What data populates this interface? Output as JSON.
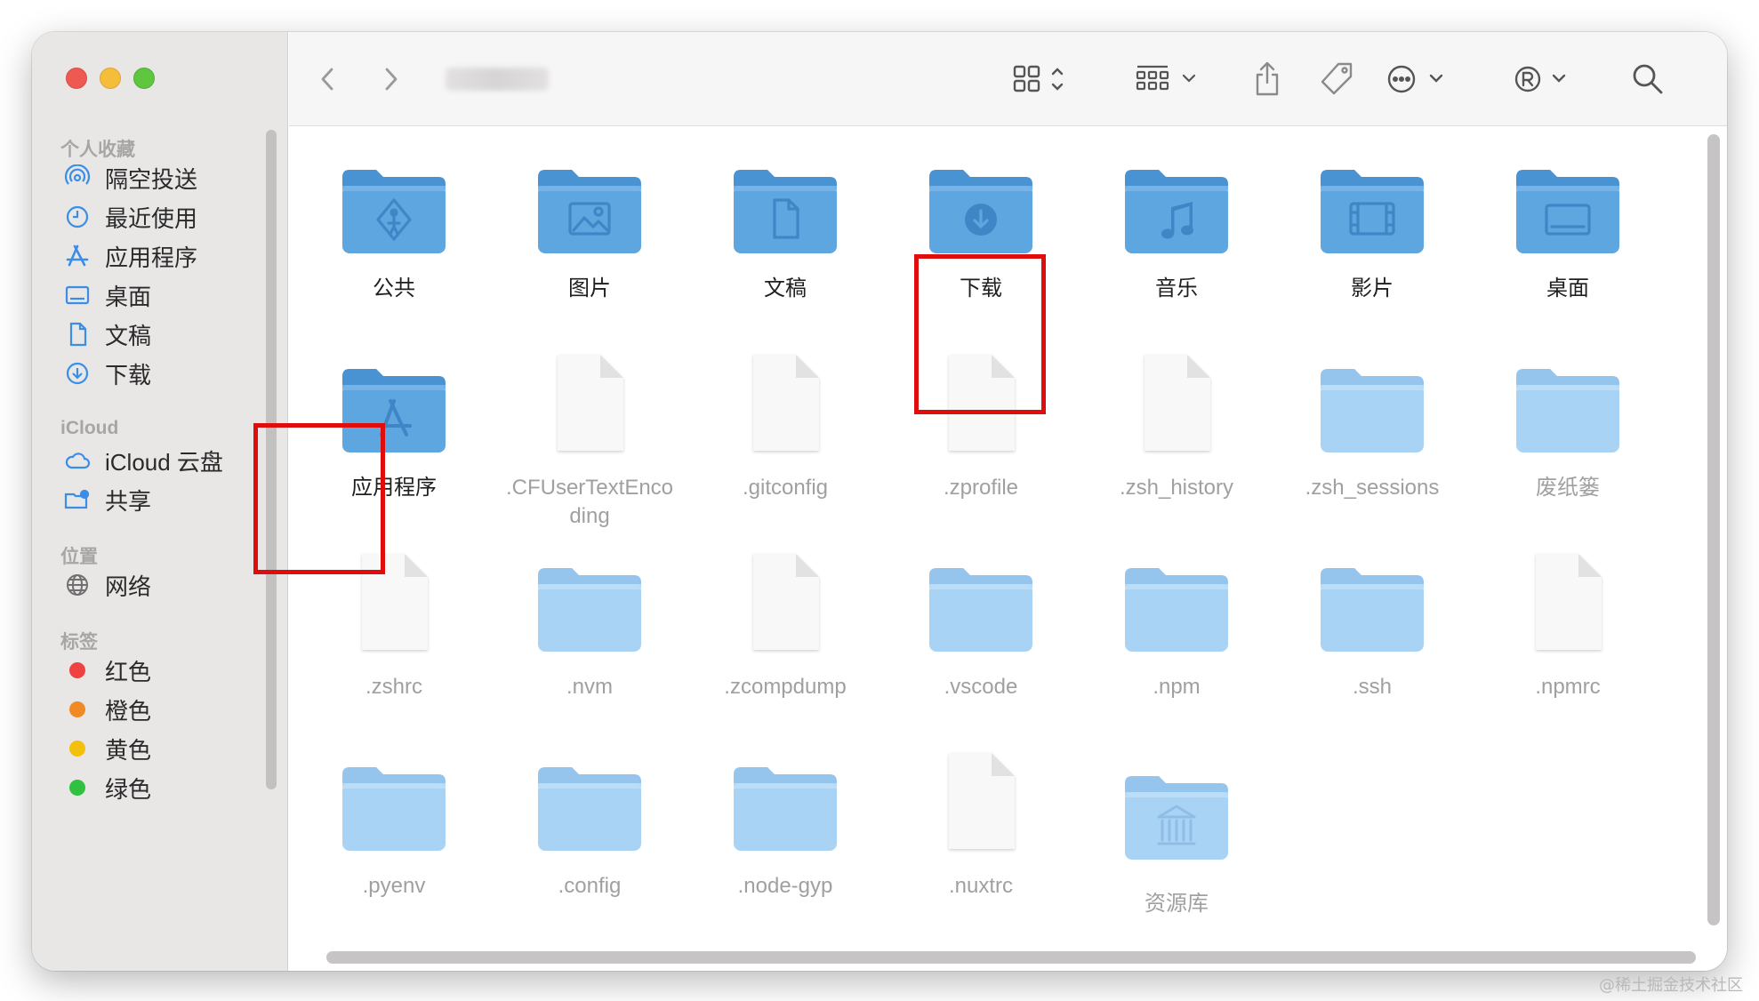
{
  "sidebar": {
    "favorites_title": "个人收藏",
    "favorites": [
      {
        "label": "隔空投送",
        "icon": "airdrop-icon"
      },
      {
        "label": "最近使用",
        "icon": "clock-icon"
      },
      {
        "label": "应用程序",
        "icon": "applications-icon"
      },
      {
        "label": "桌面",
        "icon": "desktop-icon"
      },
      {
        "label": "文稿",
        "icon": "document-icon"
      },
      {
        "label": "下载",
        "icon": "download-icon"
      }
    ],
    "icloud_title": "iCloud",
    "icloud": [
      {
        "label": "iCloud 云盘",
        "icon": "cloud-icon"
      },
      {
        "label": "共享",
        "icon": "shared-folder-icon"
      }
    ],
    "locations_title": "位置",
    "locations": [
      {
        "label": "网络",
        "icon": "globe-icon"
      }
    ],
    "tags_title": "标签",
    "tags": [
      {
        "label": "红色",
        "color": "#ee4140"
      },
      {
        "label": "橙色",
        "color": "#f08a24"
      },
      {
        "label": "黄色",
        "color": "#f3c00c"
      },
      {
        "label": "绿色",
        "color": "#2fc13f"
      }
    ]
  },
  "toolbar": {
    "icons": [
      "back-icon",
      "forward-icon",
      "icon-view-icon",
      "group-icon",
      "share-icon",
      "tag-icon",
      "more-icon",
      "account-icon",
      "search-icon"
    ]
  },
  "files": [
    {
      "name": "公共",
      "kind": "folder-public",
      "hidden": false
    },
    {
      "name": "图片",
      "kind": "folder-pictures",
      "hidden": false
    },
    {
      "name": "文稿",
      "kind": "folder-documents",
      "hidden": false
    },
    {
      "name": "下载",
      "kind": "folder-downloads",
      "hidden": false
    },
    {
      "name": "音乐",
      "kind": "folder-music",
      "hidden": false
    },
    {
      "name": "影片",
      "kind": "folder-movies",
      "hidden": false
    },
    {
      "name": "桌面",
      "kind": "folder-desktop",
      "hidden": false
    },
    {
      "name": "应用程序",
      "kind": "folder-applications",
      "hidden": false
    },
    {
      "name": ".CFUserTextEnco ding",
      "kind": "file",
      "hidden": true
    },
    {
      "name": ".gitconfig",
      "kind": "file",
      "hidden": true
    },
    {
      "name": ".zprofile",
      "kind": "file",
      "hidden": true,
      "highlighted": true
    },
    {
      "name": ".zsh_history",
      "kind": "file",
      "hidden": true
    },
    {
      "name": ".zsh_sessions",
      "kind": "folder",
      "hidden": true
    },
    {
      "name": "废纸篓",
      "kind": "folder",
      "hidden": true
    },
    {
      "name": ".zshrc",
      "kind": "file",
      "hidden": true,
      "highlighted": true
    },
    {
      "name": ".nvm",
      "kind": "folder",
      "hidden": true
    },
    {
      "name": ".zcompdump",
      "kind": "file",
      "hidden": true
    },
    {
      "name": ".vscode",
      "kind": "folder",
      "hidden": true
    },
    {
      "name": ".npm",
      "kind": "folder",
      "hidden": true
    },
    {
      "name": ".ssh",
      "kind": "folder",
      "hidden": true
    },
    {
      "name": ".npmrc",
      "kind": "file",
      "hidden": true
    },
    {
      "name": ".pyenv",
      "kind": "folder",
      "hidden": true
    },
    {
      "name": ".config",
      "kind": "folder",
      "hidden": true
    },
    {
      "name": ".node-gyp",
      "kind": "folder",
      "hidden": true
    },
    {
      "name": ".nuxtrc",
      "kind": "file",
      "hidden": true
    },
    {
      "name": "资源库",
      "kind": "folder-library",
      "hidden": true
    }
  ],
  "colors": {
    "folder_dark": "#5ea6e0",
    "folder_light": "#a9d3f4",
    "highlight": "#e00d0d"
  },
  "watermark": "@稀土掘金技术社区"
}
